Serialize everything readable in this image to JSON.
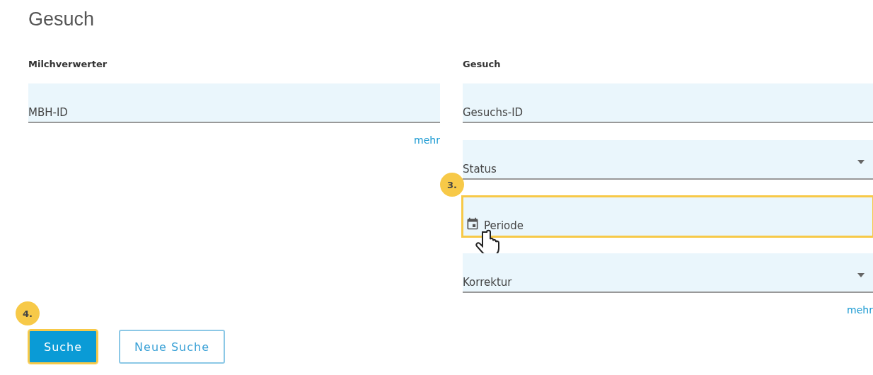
{
  "title": "Gesuch",
  "sections": [
    {
      "heading": "Milchverwerter",
      "fields": [
        {
          "kind": "text",
          "placeholder": "MBH-ID",
          "highlighted": false
        }
      ],
      "more": "mehr"
    },
    {
      "heading": "Gesuch",
      "fields": [
        {
          "kind": "text",
          "placeholder": "Gesuchs-ID",
          "highlighted": false
        },
        {
          "kind": "select",
          "placeholder": "Status",
          "highlighted": false
        },
        {
          "kind": "date",
          "placeholder": "Periode",
          "highlighted": true,
          "step": "3.",
          "pointer": true
        },
        {
          "kind": "select",
          "placeholder": "Korrektur",
          "highlighted": false
        }
      ],
      "more": "mehr"
    }
  ],
  "buttons": [
    {
      "label": "Suche",
      "kind": "primary",
      "highlighted": true,
      "step": "4."
    },
    {
      "label": "Neue Suche",
      "kind": "secondary",
      "highlighted": false
    }
  ]
}
